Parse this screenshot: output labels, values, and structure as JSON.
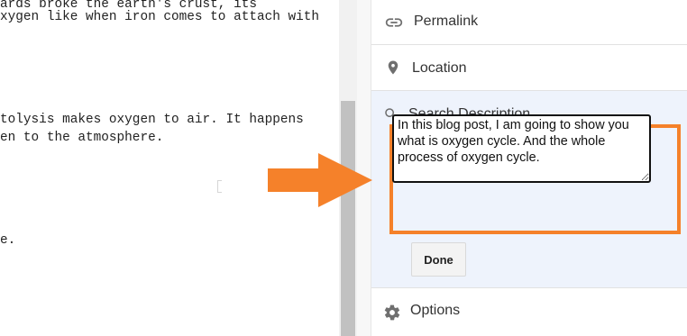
{
  "editor": {
    "lines": [
      "ards broke the earth's crust, its",
      "xygen like when iron comes to attach with",
      "tolysis makes oxygen to air. It happens",
      "en to the atmosphere.",
      "e."
    ]
  },
  "sidebar": {
    "permalink": {
      "label": "Permalink",
      "icon": "link-icon"
    },
    "location": {
      "label": "Location",
      "icon": "location-pin-icon"
    },
    "search_description": {
      "label": "Search Description",
      "icon": "search-icon",
      "value": "In this blog post, I am going to show you what is oxygen cycle. And the whole process of oxygen cycle.",
      "done_label": "Done"
    },
    "options": {
      "label": "Options",
      "icon": "gear-icon"
    }
  },
  "colors": {
    "highlight": "#f5812a",
    "arrow": "#f5812a",
    "section_bg": "#eef3fc"
  }
}
